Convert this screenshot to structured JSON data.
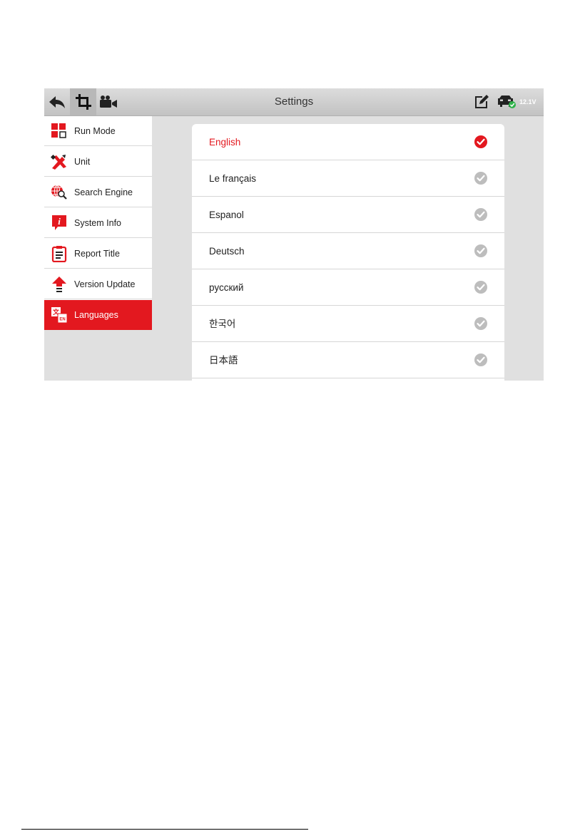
{
  "topbar": {
    "title": "Settings",
    "voltage": "12.1V",
    "icons": [
      "back-arrow-icon",
      "screenshot-crop-icon",
      "video-camera-icon",
      "edit-note-icon",
      "vehicle-connected-icon"
    ]
  },
  "sidebar": {
    "items": [
      {
        "label": "Run Mode",
        "icon": "run-mode-icon"
      },
      {
        "label": "Unit",
        "icon": "unit-ruler-icon"
      },
      {
        "label": "Search Engine",
        "icon": "search-engine-globe-icon"
      },
      {
        "label": "System Info",
        "icon": "info-icon"
      },
      {
        "label": "Report Title",
        "icon": "clipboard-icon"
      },
      {
        "label": "Version Update",
        "icon": "upload-arrow-icon"
      },
      {
        "label": "Languages",
        "icon": "translate-icon"
      }
    ],
    "active": "Languages"
  },
  "languages": {
    "items": [
      {
        "label": "English",
        "selected": true
      },
      {
        "label": "Le français",
        "selected": false
      },
      {
        "label": "Espanol",
        "selected": false
      },
      {
        "label": "Deutsch",
        "selected": false
      },
      {
        "label": "русский",
        "selected": false
      },
      {
        "label": "한국어",
        "selected": false
      },
      {
        "label": "日本語",
        "selected": false
      }
    ]
  },
  "colors": {
    "accent": "#e3181f",
    "unselected_check": "#bdbdbd",
    "content_background": "#e0e0e0",
    "topbar": "#cfcfcf"
  }
}
